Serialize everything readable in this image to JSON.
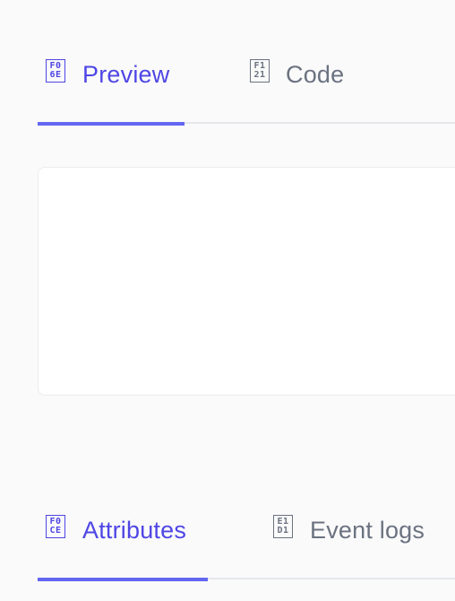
{
  "top_tabs": {
    "preview": {
      "label": "Preview",
      "icon": "missing-glyph-icon",
      "glyph_top": "F0",
      "glyph_bottom": "6E",
      "active": true
    },
    "code": {
      "label": "Code",
      "icon": "missing-glyph-icon",
      "glyph_top": "F1",
      "glyph_bottom": "21",
      "active": false
    }
  },
  "bottom_tabs": {
    "attributes": {
      "label": "Attributes",
      "icon": "missing-glyph-icon",
      "glyph_top": "F0",
      "glyph_bottom": "CE",
      "active": true
    },
    "event_logs": {
      "label": "Event logs",
      "icon": "missing-glyph-icon",
      "glyph_top": "E1",
      "glyph_bottom": "D1",
      "active": false
    }
  },
  "colors": {
    "accent": "#4f46e5",
    "accent_underline": "#6366f1",
    "inactive_text": "#6b7280",
    "divider": "#e5e7eb",
    "background": "#fafafa",
    "panel": "#ffffff"
  }
}
